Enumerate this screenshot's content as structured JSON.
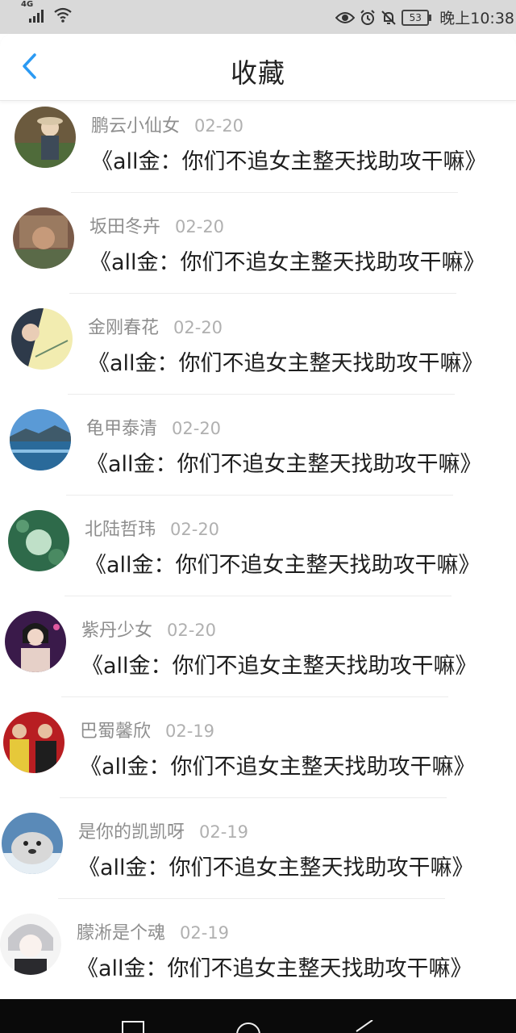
{
  "status_bar": {
    "network_label": "4G",
    "battery_level": "53",
    "time": "晚上10:38"
  },
  "header": {
    "title": "收藏"
  },
  "colors": {
    "accent": "#2b9af3",
    "author_gray": "#8e8e8e",
    "date_gray": "#b0b0b0"
  },
  "items": [
    {
      "author": "鹏云小仙女",
      "date": "02-20",
      "title": "《all金：你们不追女主整天找助攻干嘛》"
    },
    {
      "author": "坂田冬卉",
      "date": "02-20",
      "title": "《all金：你们不追女主整天找助攻干嘛》"
    },
    {
      "author": "金刚春花",
      "date": "02-20",
      "title": "《all金：你们不追女主整天找助攻干嘛》"
    },
    {
      "author": "龟甲泰清",
      "date": "02-20",
      "title": "《all金：你们不追女主整天找助攻干嘛》"
    },
    {
      "author": "北陆哲玮",
      "date": "02-20",
      "title": "《all金：你们不追女主整天找助攻干嘛》"
    },
    {
      "author": "紫丹少女",
      "date": "02-20",
      "title": "《all金：你们不追女主整天找助攻干嘛》"
    },
    {
      "author": "巴蜀馨欣",
      "date": "02-19",
      "title": "《all金：你们不追女主整天找助攻干嘛》"
    },
    {
      "author": "是你的凯凯呀",
      "date": "02-19",
      "title": "《all金：你们不追女主整天找助攻干嘛》"
    },
    {
      "author": "朦淅是个魂",
      "date": "02-19",
      "title": "《all金：你们不追女主整天找助攻干嘛》"
    }
  ]
}
